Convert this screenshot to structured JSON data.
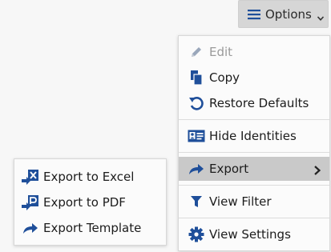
{
  "options_button": {
    "label": "Options",
    "icon": "menu-lines-icon",
    "chevron": "chevron-down-icon"
  },
  "main_menu": {
    "items": [
      {
        "label": "Edit",
        "icon": "pencil-icon",
        "state": "disabled"
      },
      {
        "label": "Copy",
        "icon": "copy-icon"
      },
      {
        "label": "Restore Defaults",
        "icon": "restore-icon"
      },
      {
        "label": "Hide Identities",
        "icon": "id-card-icon"
      },
      {
        "label": "Export",
        "icon": "share-arrow-icon",
        "state": "highlighted",
        "submenu": true
      },
      {
        "label": "View Filter",
        "icon": "filter-icon"
      },
      {
        "label": "View Settings",
        "icon": "gear-icon"
      }
    ]
  },
  "export_submenu": {
    "items": [
      {
        "label": "Export to Excel",
        "icon": "excel-export-icon"
      },
      {
        "label": "Export to PDF",
        "icon": "pdf-export-icon"
      },
      {
        "label": "Export Template",
        "icon": "share-arrow-icon"
      }
    ]
  },
  "colors": {
    "icon_blue": "#1f4f9a",
    "disabled_gray": "#9a9a9a",
    "highlight_bg": "#c9c9c9",
    "button_bg": "#d6d6d6"
  }
}
